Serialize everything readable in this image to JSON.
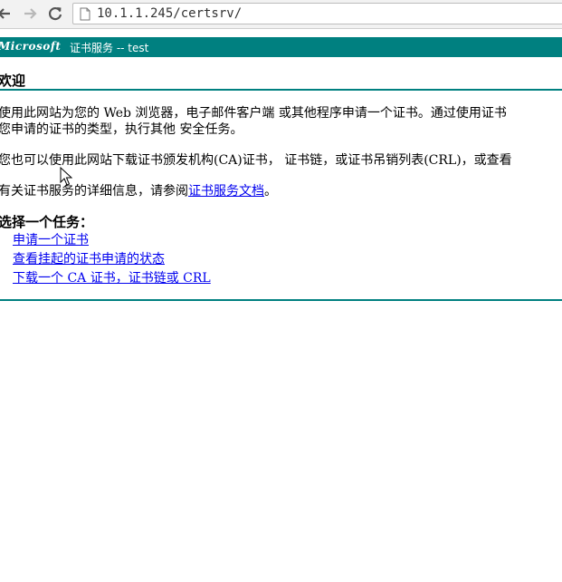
{
  "browser": {
    "url": "10.1.1.245/certsrv/"
  },
  "header": {
    "brand": "Microsoft",
    "service_title": "证书服务  --  test"
  },
  "page": {
    "title": "欢迎",
    "para1_line1": "使用此网站为您的 Web 浏览器，电子邮件客户端 或其他程序申请一个证书。通过使用证书",
    "para1_line2": "您申请的证书的类型，执行其他 安全任务。",
    "para2": "您也可以使用此网站下载证书颁发机构(CA)证书，  证书链，或证书吊销列表(CRL)，或查看",
    "para3_prefix": "有关证书服务的详细信息，请参阅",
    "para3_link": "证书服务文档",
    "para3_suffix": "。"
  },
  "tasks": {
    "heading": "选择一个任务：",
    "items": [
      "申请一个证书",
      "查看挂起的证书申请的状态",
      "下载一个 CA 证书，证书链或 CRL"
    ]
  },
  "colors": {
    "teal": "#008080",
    "link": "#0000ee"
  }
}
